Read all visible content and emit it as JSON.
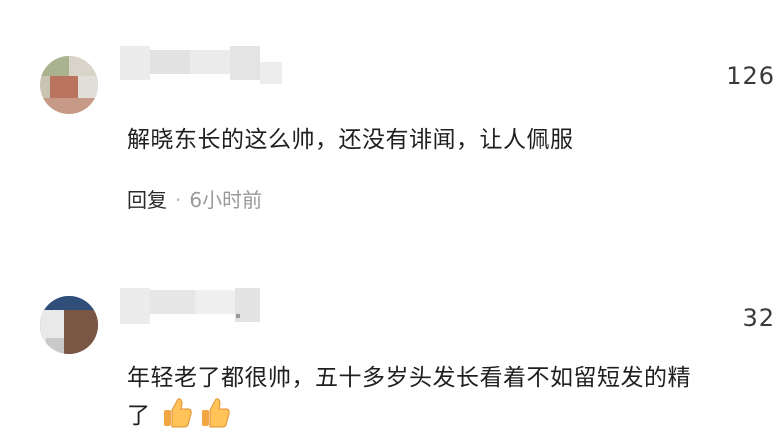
{
  "comments": [
    {
      "likes": "126",
      "text": "解晓东长的这么帅，还没有诽闻，让人佩服",
      "reply_label": "回复",
      "separator": "·",
      "time": "6小时前"
    },
    {
      "likes": "32",
      "text": "年轻老了都很帅，五十多岁头发长看着不如留短发的精",
      "text_line2": "了",
      "emoji_names": [
        "thumbs-up-icon",
        "thumbs-up-icon"
      ]
    }
  ],
  "colors": {
    "background": "#ffffff",
    "text": "#1f1f1f",
    "meta": "#9a9a9a",
    "blur_gray": "#e6e6e6"
  }
}
